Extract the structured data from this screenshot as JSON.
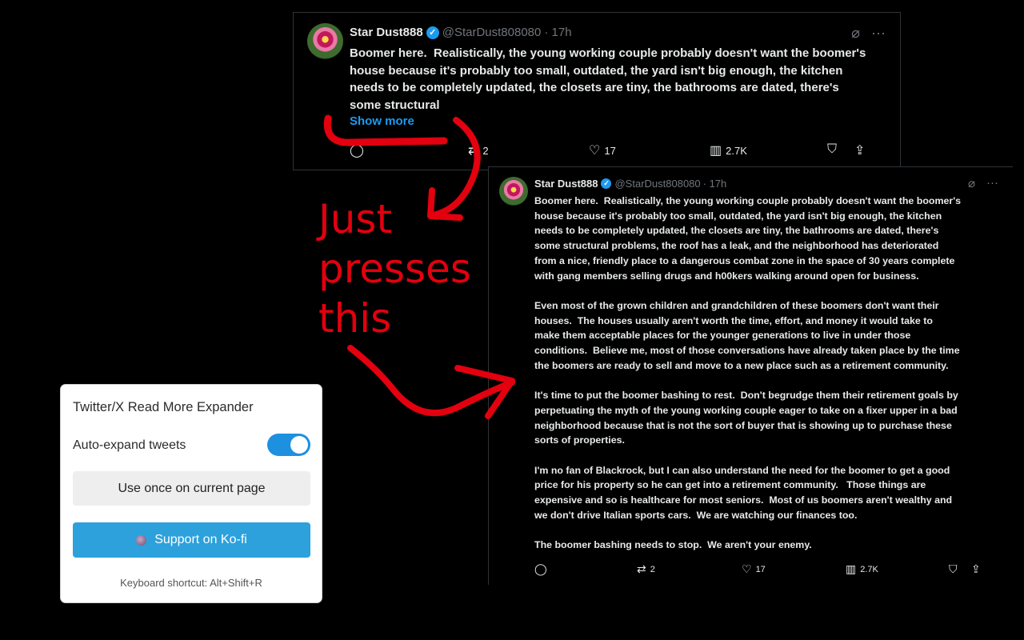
{
  "tweet_collapsed": {
    "author": "Star Dust888",
    "handle": "@StarDust808080",
    "time": "· 17h",
    "text": "Boomer here.  Realistically, the young working couple probably doesn't want the boomer's\nhouse because it's probably too small, outdated, the yard isn't big enough, the kitchen\nneeds to be completely updated, the closets are tiny, the bathrooms are dated, there's\nsome structural",
    "show_more": "Show more",
    "retweets": "2",
    "likes": "17",
    "views": "2.7K"
  },
  "tweet_expanded": {
    "author": "Star Dust888",
    "handle": "@StarDust808080",
    "time": "· 17h",
    "text": "Boomer here.  Realistically, the young working couple probably doesn't want the boomer's\nhouse because it's probably too small, outdated, the yard isn't big enough, the kitchen\nneeds to be completely updated, the closets are tiny, the bathrooms are dated, there's\nsome structural problems, the roof has a leak, and the neighborhood has deteriorated\nfrom a nice, friendly place to a dangerous combat zone in the space of 30 years complete\nwith gang members selling drugs and h00kers walking around open for business.\n\nEven most of the grown children and grandchildren of these boomers don't want their\nhouses.  The houses usually aren't worth the time, effort, and money it would take to\nmake them acceptable places for the younger generations to live in under those\nconditions.  Believe me, most of those conversations have already taken place by the time\nthe boomers are ready to sell and move to a new place such as a retirement community.\n\nIt's time to put the boomer bashing to rest.  Don't begrudge them their retirement goals by\nperpetuating the myth of the young working couple eager to take on a fixer upper in a bad\nneighborhood because that is not the sort of buyer that is showing up to purchase these\nsorts of properties.\n\nI'm no fan of Blackrock, but I can also understand the need for the boomer to get a good\nprice for his property so he can get into a retirement community.   Those things are\nexpensive and so is healthcare for most seniors.  Most of us boomers aren't wealthy and\nwe don't drive Italian sports cars.  We are watching our finances too.\n\nThe boomer bashing needs to stop.  We aren't your enemy.",
    "retweets": "2",
    "likes": "17",
    "views": "2.7K"
  },
  "annotation": "Just\npresses\nthis",
  "popup": {
    "title": "Twitter/X Read More Expander",
    "auto_expand_label": "Auto-expand tweets",
    "auto_expand_on": true,
    "use_once_label": "Use once on current page",
    "support_label": "Support on Ko-fi",
    "shortcut_text": "Keyboard shortcut: Alt+Shift+R"
  },
  "colors": {
    "accent_blue": "#1d9bf0",
    "annotation_red": "#e3000f",
    "toggle_blue": "#1e90e0",
    "kofi_blue": "#2ca1dc"
  },
  "icons": [
    "verified-icon",
    "grok-icon",
    "more-icon",
    "reply-icon",
    "retweet-icon",
    "like-icon",
    "views-icon",
    "bookmark-icon",
    "share-icon"
  ]
}
